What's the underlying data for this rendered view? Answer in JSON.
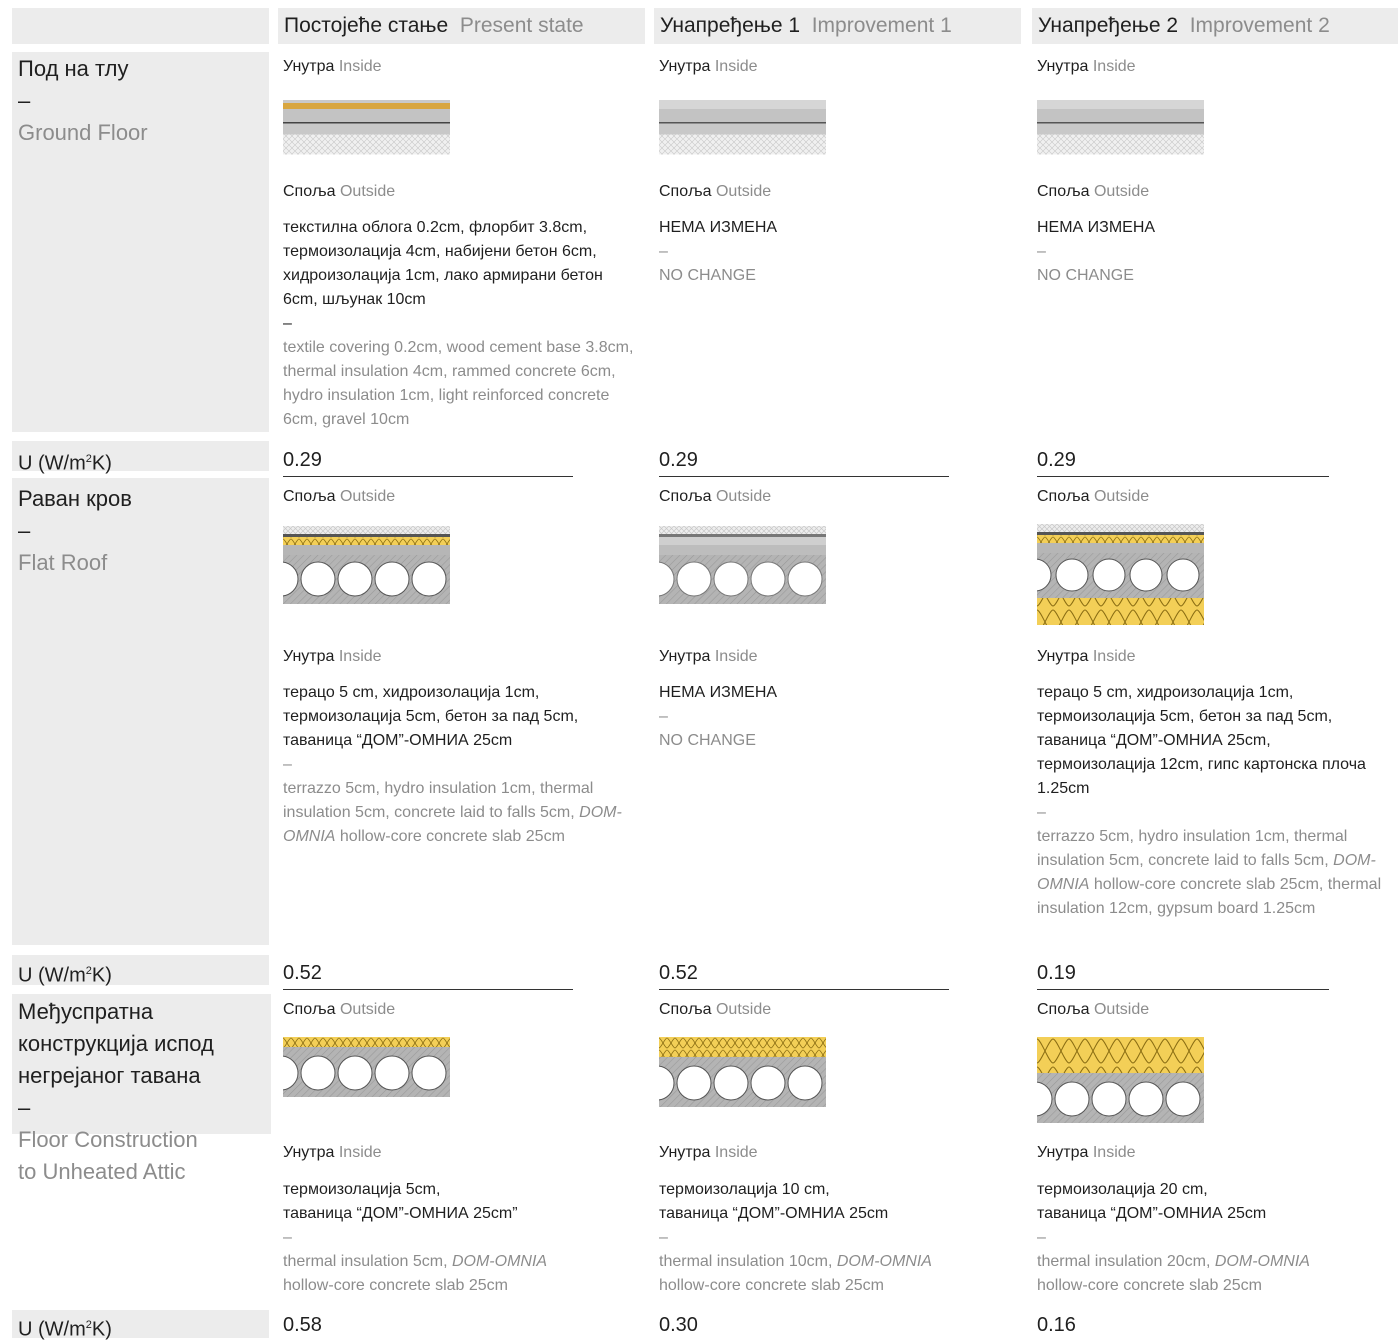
{
  "columns": [
    {
      "sr": "Постојеће стање",
      "en": "Present state"
    },
    {
      "sr": "Унапређење 1",
      "en": "Improvement 1"
    },
    {
      "sr": "Унапређење 2",
      "en": "Improvement 2"
    }
  ],
  "labels": {
    "inside_sr": "Унутра",
    "inside_en": "Inside",
    "outside_sr": "Споља",
    "outside_en": "Outside",
    "dash": "–",
    "u_prefix": "U (W/m",
    "u_sup": "2",
    "u_suffix": "K)"
  },
  "rows": [
    {
      "name_sr": "Под на тлу",
      "name_en": "Ground Floor",
      "u_values": [
        "0.29",
        "0.29",
        "0.29"
      ],
      "cells": [
        {
          "sr": "текстилна облога 0.2cm, флорбит 3.8cm, термоизолација 4cm, набијени бетон 6cm, хидроизолација 1cm, лако армирани бетон 6cm, шљунак 10cm",
          "en": "textile covering 0.2cm, wood cement base 3.8cm, thermal insulation 4cm, rammed concrete 6cm, hydro insulation 1cm, light reinforced concrete 6cm, gravel 10cm"
        },
        {
          "sr": "НЕМА ИЗМЕНА",
          "en": "NO CHANGE"
        },
        {
          "sr": "НЕМА ИЗМЕНА",
          "en": "NO CHANGE"
        }
      ]
    },
    {
      "name_sr": "Раван кров",
      "name_en": "Flat Roof",
      "u_values": [
        "0.52",
        "0.52",
        "0.19"
      ],
      "cells": [
        {
          "sr": "терацо 5 cm, хидроизолација 1cm, термоизолација 5cm, бетон за пад  5cm, таваница “ДОМ”-ОМНИА 25cm",
          "en_italic": "DOM-OMNIA",
          "en_pre": "terrazzo 5cm, hydro insulation 1cm, thermal insulation 5cm, concrete laid to falls 5cm, ",
          "en_post": " hollow-core concrete slab 25cm"
        },
        {
          "sr": "НЕМА ИЗМЕНА",
          "en": "NO CHANGE"
        },
        {
          "sr": "терацо 5 cm, хидроизолација 1cm, термоизолација 5cm, бетон за пад 5cm, таваница “ДОМ”-ОМНИА 25cm, термоизолација 12cm, гипс картонска плоча 1.25cm",
          "en_italic": "DOM-OMNIA",
          "en_pre": "terrazzo 5cm, hydro insulation 1cm, thermal insulation 5cm, concrete laid to falls 5cm, ",
          "en_post": " hollow-core concrete slab 25cm, thermal insulation 12cm, gypsum board 1.25cm"
        }
      ]
    },
    {
      "name_sr_1": "Међуспратна",
      "name_sr_2": "конструкција испод",
      "name_sr_3": "негрејаног тавана",
      "name_en_1": "Floor Construction",
      "name_en_2": "to Unheated Attic",
      "u_values": [
        "0.58",
        "0.30",
        "0.16"
      ],
      "cells": [
        {
          "sr_1": "термоизолација 5cm,",
          "sr_2": "таваница “ДОМ”-ОМНИА 25cm”",
          "en_pre": "thermal insulation 5cm, ",
          "en_italic": "DOM-OMNIA",
          "en_post": "hollow-core concrete slab 25cm"
        },
        {
          "sr_1": "термоизолација 10 cm,",
          "sr_2": "таваница “ДОМ”-ОМНИА 25cm",
          "en_pre": "thermal insulation 10cm, ",
          "en_italic": "DOM-OMNIA",
          "en_post": "hollow-core concrete slab 25cm"
        },
        {
          "sr_1": "термоизолација 20 cm,",
          "sr_2": "таваница “ДОМ”-ОМНИА 25cm",
          "en_pre": "thermal insulation 20cm, ",
          "en_italic": "DOM-OMNIA",
          "en_post": "hollow-core concrete slab 25cm"
        }
      ]
    }
  ],
  "colors": {
    "band": "#ececec",
    "insulation": "#f2c94c",
    "concrete": "#a9a9a9",
    "muted": "#8c8c8c"
  }
}
